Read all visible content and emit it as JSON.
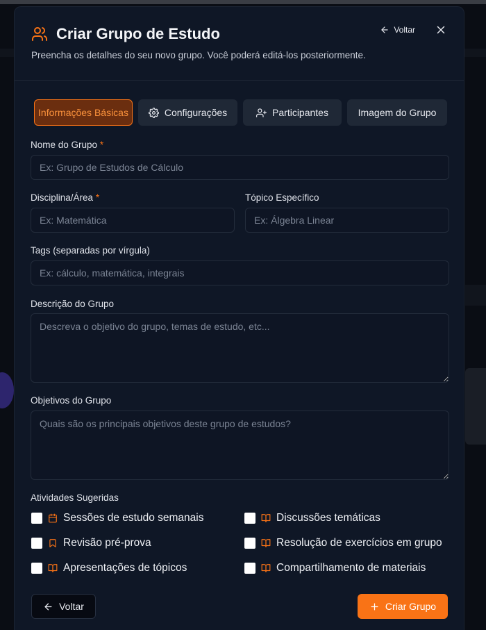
{
  "modal": {
    "title": "Criar Grupo de Estudo",
    "subtitle": "Preencha os detalhes do seu novo grupo. Você poderá editá-los posteriormente.",
    "back_top_label": "Voltar"
  },
  "tabs": [
    {
      "label": "Informações Básicas",
      "icon": "none",
      "active": true
    },
    {
      "label": "Configurações",
      "icon": "gear-icon"
    },
    {
      "label": "Participantes",
      "icon": "user-plus-icon"
    },
    {
      "label": "Imagem do Grupo",
      "icon": "none"
    }
  ],
  "form": {
    "name": {
      "label": "Nome do Grupo",
      "required": "*",
      "placeholder": "Ex: Grupo de Estudos de Cálculo",
      "value": ""
    },
    "discipline": {
      "label": "Disciplina/Área",
      "required": "*",
      "placeholder": "Ex: Matemática",
      "value": ""
    },
    "topic": {
      "label": "Tópico Específico",
      "placeholder": "Ex: Álgebra Linear",
      "value": ""
    },
    "tags": {
      "label": "Tags (separadas por vírgula)",
      "placeholder": "Ex: cálculo, matemática, integrais",
      "value": ""
    },
    "description": {
      "label": "Descrição do Grupo",
      "placeholder": "Descreva o objetivo do grupo, temas de estudo, etc...",
      "value": ""
    },
    "objectives": {
      "label": "Objetivos do Grupo",
      "placeholder": "Quais são os principais objetivos deste grupo de estudos?",
      "value": ""
    }
  },
  "activities": {
    "label": "Atividades Sugeridas",
    "items": [
      {
        "label": "Sessões de estudo semanais",
        "icon": "calendar-icon",
        "checked": false
      },
      {
        "label": "Discussões temáticas",
        "icon": "book-open-icon",
        "checked": false
      },
      {
        "label": "Revisão pré-prova",
        "icon": "bookmark-icon",
        "checked": false
      },
      {
        "label": "Resolução de exercícios em grupo",
        "icon": "book-open-icon",
        "checked": false
      },
      {
        "label": "Apresentações de tópicos",
        "icon": "book-open-icon",
        "checked": false
      },
      {
        "label": "Compartilhamento de materiais",
        "icon": "book-open-icon",
        "checked": false
      }
    ]
  },
  "footer": {
    "back_label": "Voltar",
    "create_label": "Criar Grupo"
  },
  "colors": {
    "accent": "#f97316",
    "background": "#0f1726",
    "input_bg": "#0e1524",
    "text": "#e6e8ee"
  }
}
